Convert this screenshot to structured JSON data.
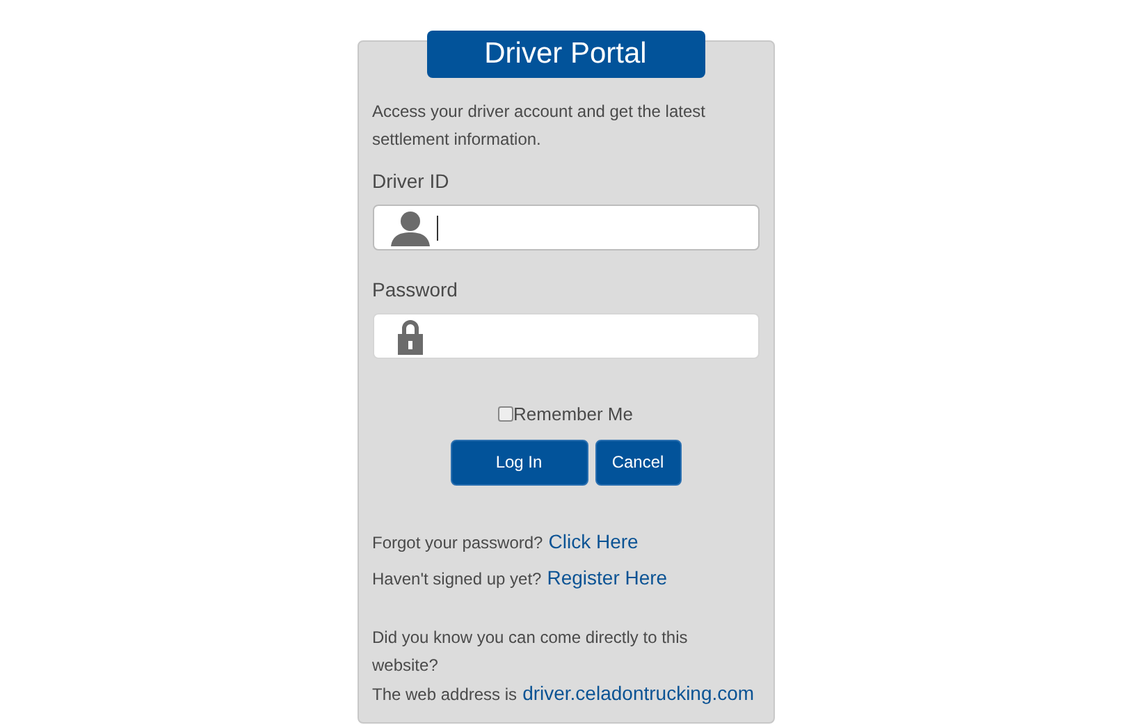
{
  "title": "Driver Portal",
  "intro": "Access your driver account and get the latest settlement information.",
  "fields": [
    {
      "label": "Driver ID",
      "kind": "user",
      "focused": true
    },
    {
      "label": "Password",
      "kind": "lock",
      "focused": false
    }
  ],
  "remember": {
    "label": "Remember Me",
    "checked": false
  },
  "buttons": [
    "Log In",
    "Cancel"
  ],
  "links": [
    {
      "text": "Forgot your password?",
      "link": "Click Here"
    },
    {
      "text": "Haven't signed up yet?",
      "link": "Register Here"
    }
  ],
  "notice": {
    "text": "Did you know you can come directly to this website?",
    "address_text": "The web address is",
    "address_link": "driver.celadontrucking.com"
  }
}
